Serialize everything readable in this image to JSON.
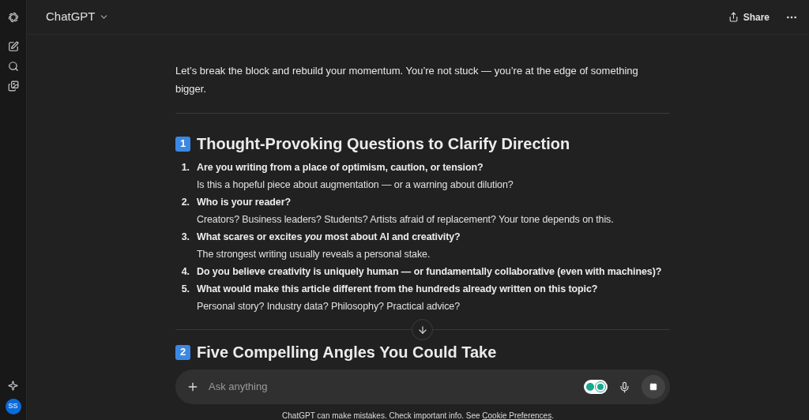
{
  "header": {
    "title": "ChatGPT",
    "share": "Share"
  },
  "sidebar": {
    "avatar": "SS"
  },
  "intro": "Let’s break the block and rebuild your momentum. You’re not stuck — you’re at the edge of something bigger.",
  "sections": [
    {
      "number": "1",
      "title": "Thought-Provoking Questions to Clarify Direction",
      "items": [
        {
          "number": "1.",
          "question": "Are you writing from a place of optimism, caution, or tension?",
          "detail": "Is this a hopeful piece about augmentation — or a warning about dilution?"
        },
        {
          "number": "2.",
          "question": "Who is your reader?",
          "detail": "Creators? Business leaders? Students? Artists afraid of replacement? Your tone depends on this."
        },
        {
          "number": "3.",
          "question": "What scares or excites *you* most about AI and creativity?",
          "detail": "The strongest writing usually reveals a personal stake."
        },
        {
          "number": "4.",
          "question": "Do you believe creativity is uniquely human — or fundamentally collaborative (even with machines)?"
        },
        {
          "number": "5.",
          "question": "What would make this article different from the hundreds already written on this topic?",
          "detail": "Personal story? Industry data? Philosophy? Practical advice?"
        }
      ]
    },
    {
      "number": "2",
      "title": "Five Compelling Angles You Could Take"
    }
  ],
  "composer": {
    "placeholder": "Ask anything"
  },
  "footer": {
    "text": "ChatGPT can make mistakes. Check important info. See",
    "link": "Cookie Preferences",
    "end": "."
  }
}
